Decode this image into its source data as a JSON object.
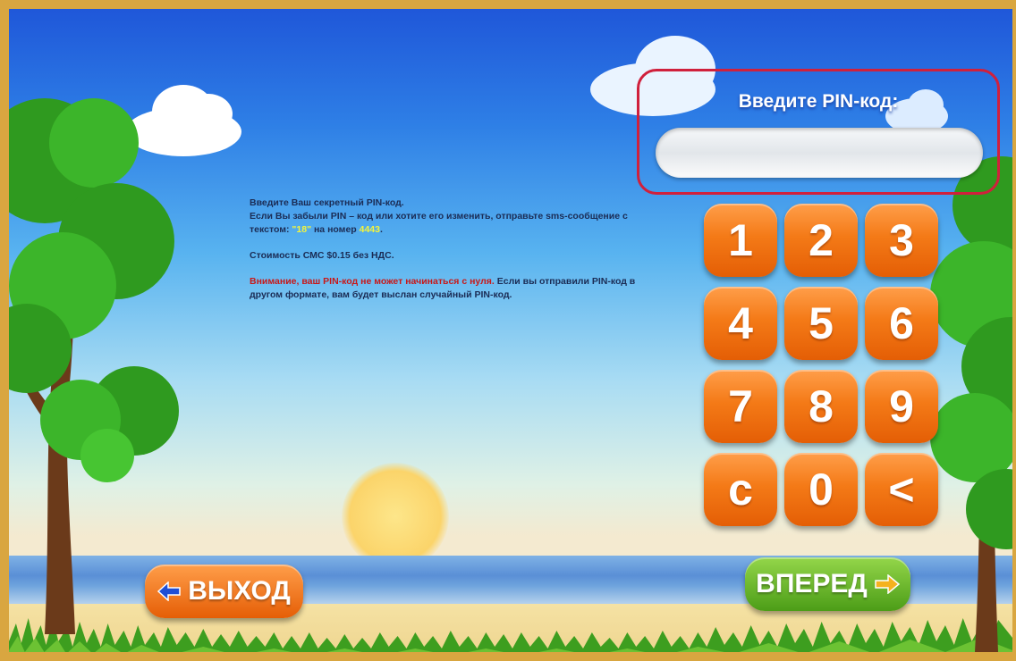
{
  "pin": {
    "label": "Введите PIN-код:",
    "value": ""
  },
  "instructions": {
    "line1": "Введите Ваш секретный PIN-код.",
    "line2": " Если Вы забыли PIN – код или хотите его изменить, отправьте sms-сообщение с текстом: ",
    "sms_text": "\"18\"",
    "line2b": " на номер ",
    "sms_number": "4443",
    "line2c": ".",
    "cost": "Стоимость СМС $0.15 без НДС.",
    "warning": "Внимание, ваш PIN-код не может начинаться с нуля.",
    "warning_rest": " Если вы отправили PIN-код в другом формате, вам будет выслан случайный PIN-код."
  },
  "keypad": {
    "k1": "1",
    "k2": "2",
    "k3": "3",
    "k4": "4",
    "k5": "5",
    "k6": "6",
    "k7": "7",
    "k8": "8",
    "k9": "9",
    "clear": "c",
    "k0": "0",
    "back": "<"
  },
  "nav": {
    "exit_label": "ВЫХОД",
    "exit_icon": "arrow-left-icon",
    "next_label": "ВПЕРЕД",
    "next_icon": "arrow-right-icon"
  },
  "colors": {
    "key_orange": "#f47a17",
    "next_green": "#6bb52a",
    "frame_gold": "#d9a640",
    "panel_border_red": "#d0203c"
  }
}
